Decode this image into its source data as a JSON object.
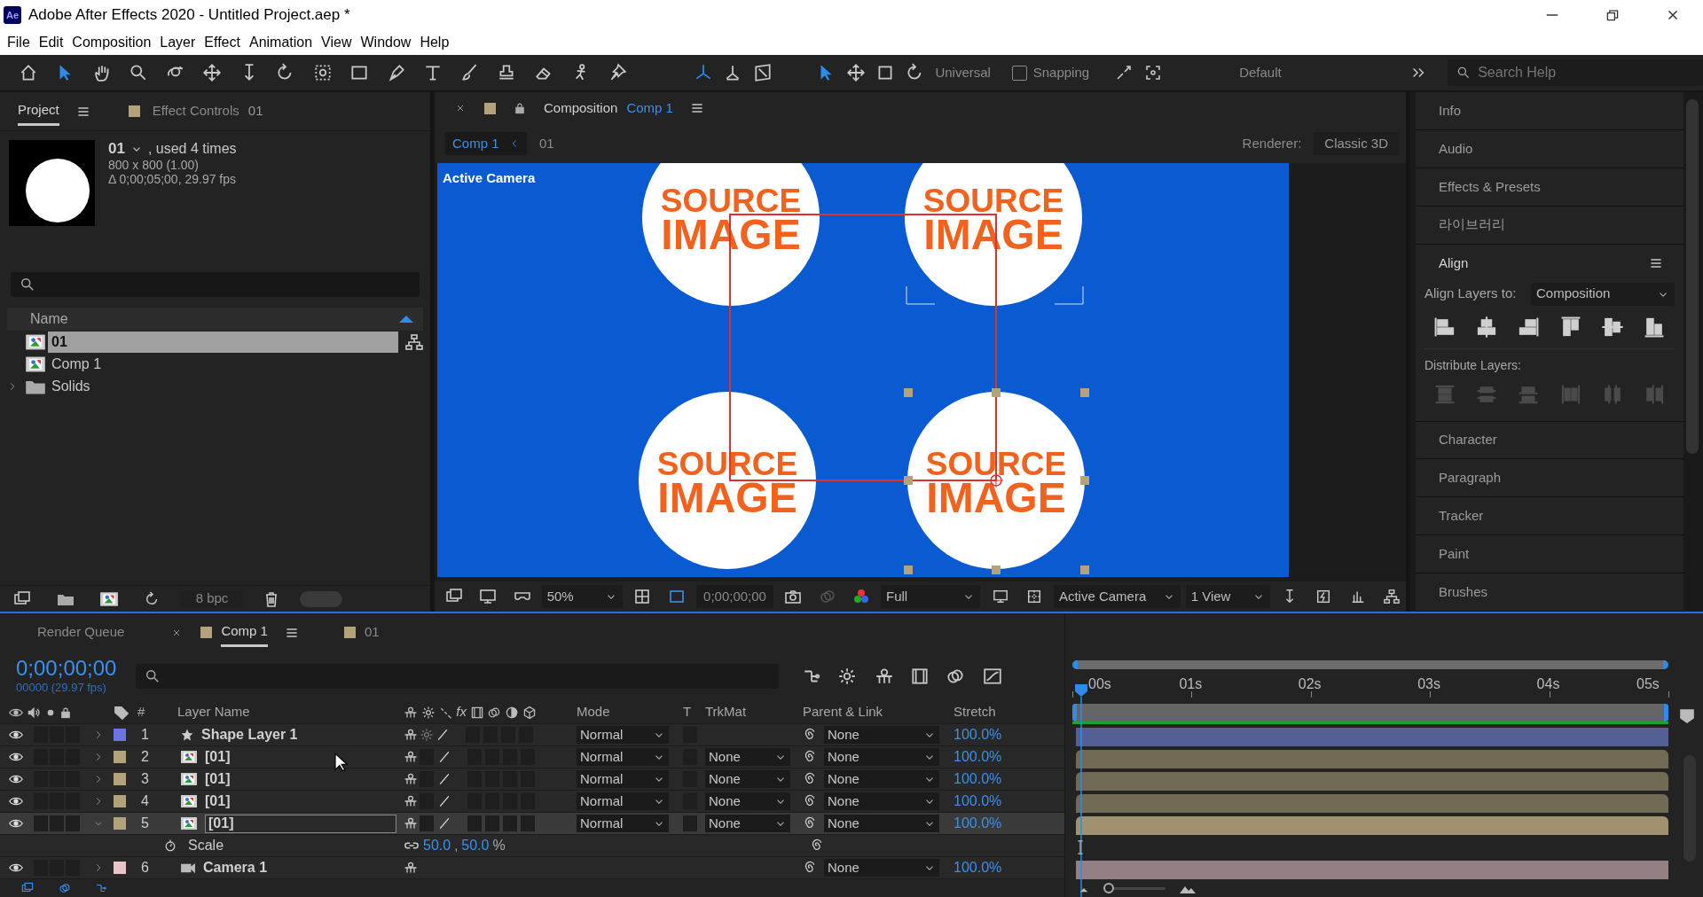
{
  "window": {
    "app_icon": "Ae",
    "title": "Adobe After Effects 2020 - Untitled Project.aep *"
  },
  "menu": [
    "File",
    "Edit",
    "Composition",
    "Layer",
    "Effect",
    "Animation",
    "View",
    "Window",
    "Help"
  ],
  "toolbar": {
    "tools": [
      {
        "selected": false
      },
      {
        "selected": true
      },
      {
        "selected": false
      },
      {
        "selected": false
      },
      {
        "selected": false
      },
      {
        "selected": false
      },
      {
        "selected": false
      },
      {
        "selected": false
      },
      {
        "selected": false
      },
      {
        "selected": false
      },
      {
        "selected": false
      },
      {
        "selected": false
      },
      {
        "selected": false
      },
      {
        "selected": false
      },
      {
        "selected": false
      },
      {
        "selected": false
      },
      {
        "selected": false
      }
    ],
    "axis_modes": [
      {
        "selected": true
      },
      {
        "selected": false
      },
      {
        "selected": false
      }
    ],
    "transform_tools": [
      {
        "selected": true
      },
      {
        "selected": false
      },
      {
        "selected": false
      },
      {
        "selected": false
      }
    ],
    "transform_label": "Universal",
    "snapping": {
      "label": "Snapping",
      "checked": false
    },
    "workspace": "Default",
    "search": {
      "placeholder": "Search Help"
    }
  },
  "project_panel": {
    "tabs": [
      {
        "label": "Project",
        "selected": true
      },
      {
        "label": "Effect Controls",
        "suffix": "01",
        "selected": false
      }
    ],
    "preview": {
      "name": "01",
      "usage": ", used 4 times",
      "size": "800 x 800 (1.00)",
      "duration": "Δ 0;00;05;00, 29.97 fps"
    },
    "column": "Name",
    "items": [
      {
        "name": "01",
        "kind": "footage",
        "selected": true
      },
      {
        "name": "Comp 1",
        "kind": "composition",
        "selected": false
      },
      {
        "name": "Solids",
        "kind": "folder",
        "selected": false,
        "expanded": false
      }
    ],
    "bit_depth": "8 bpc"
  },
  "composition_panel": {
    "tab_label": "Composition",
    "comp_name": "Comp 1",
    "breadcrumbs": [
      {
        "label": "Comp 1",
        "selected": true
      },
      {
        "label": "01",
        "selected": false
      }
    ],
    "renderer_label": "Renderer:",
    "renderer": "Classic 3D",
    "viewer": {
      "camera_label": "Active Camera",
      "tiles": [
        {
          "line_1": "SOURCE",
          "line_2": "IMAGE"
        },
        {
          "line_1": "SOURCE",
          "line_2": "IMAGE"
        },
        {
          "line_1": "SOURCE",
          "line_2": "IMAGE"
        },
        {
          "line_1": "SOURCE",
          "line_2": "IMAGE"
        }
      ]
    },
    "footer": {
      "magnification": "50%",
      "timecode": "0;00;00;00",
      "resolution": "Full",
      "view": "Active Camera",
      "layout": "1 View"
    }
  },
  "side_panels": [
    {
      "label": "Info",
      "expanded": false
    },
    {
      "label": "Audio",
      "expanded": false
    },
    {
      "label": "Effects & Presets",
      "expanded": false
    },
    {
      "label": "라이브러리",
      "expanded": false
    },
    {
      "label": "Align",
      "expanded": true
    },
    {
      "label": "Character",
      "expanded": false
    },
    {
      "label": "Paragraph",
      "expanded": false
    },
    {
      "label": "Tracker",
      "expanded": false
    },
    {
      "label": "Paint",
      "expanded": false
    },
    {
      "label": "Brushes",
      "expanded": false
    }
  ],
  "align_panel": {
    "align_to_label": "Align Layers to:",
    "align_to": "Composition",
    "distribute_label": "Distribute Layers:",
    "distribute_disabled": true
  },
  "timeline": {
    "tabs": [
      {
        "label": "Render Queue",
        "kind": "queue",
        "selected": false
      },
      {
        "label": "Comp 1",
        "kind": "composition",
        "selected": true
      },
      {
        "label": "01",
        "kind": "composition",
        "selected": false
      }
    ],
    "current_time": "0;00;00;00",
    "frame_rate": "00000 (29.97 fps)",
    "columns": {
      "number": "#",
      "layer_name": "Layer Name",
      "fx": "fx",
      "mode": "Mode",
      "t": "T",
      "trkmat": "TrkMat",
      "parent": "Parent & Link",
      "stretch": "Stretch"
    },
    "layers": [
      {
        "number": "1",
        "name": "Shape Layer 1",
        "kind": "shape",
        "color": "#6b74e0",
        "visible": true,
        "selected": false,
        "expanded": false,
        "mode": "Normal",
        "parent": "None",
        "stretch": "100.0%"
      },
      {
        "number": "2",
        "name": "[01]",
        "kind": "footage",
        "color": "#b3a37d",
        "visible": true,
        "selected": false,
        "expanded": false,
        "mode": "Normal",
        "trkmat": "None",
        "parent": "None",
        "stretch": "100.0%"
      },
      {
        "number": "3",
        "name": "[01]",
        "kind": "footage",
        "color": "#b3a37d",
        "visible": true,
        "selected": false,
        "expanded": false,
        "mode": "Normal",
        "trkmat": "None",
        "parent": "None",
        "stretch": "100.0%"
      },
      {
        "number": "4",
        "name": "[01]",
        "kind": "footage",
        "color": "#b3a37d",
        "visible": true,
        "selected": false,
        "expanded": false,
        "mode": "Normal",
        "trkmat": "None",
        "parent": "None",
        "stretch": "100.0%"
      },
      {
        "number": "5",
        "name": "[01]",
        "kind": "footage",
        "color": "#b3a37d",
        "visible": true,
        "selected": true,
        "expanded": true,
        "mode": "Normal",
        "trkmat": "None",
        "parent": "None",
        "stretch": "100.0%",
        "properties": [
          {
            "name": "Scale",
            "values": [
              "50.0",
              "50.0"
            ],
            "separator": ",",
            "unit": "%"
          }
        ]
      },
      {
        "number": "6",
        "name": "Camera 1",
        "kind": "camera",
        "color": "#e8c5c9",
        "visible": true,
        "selected": false,
        "expanded": false,
        "parent": "None",
        "stretch": "100.0%"
      }
    ],
    "ruler": [
      "00s",
      "01s",
      "02s",
      "03s",
      "04s",
      "05s"
    ],
    "zoom": {
      "level": 0
    }
  }
}
